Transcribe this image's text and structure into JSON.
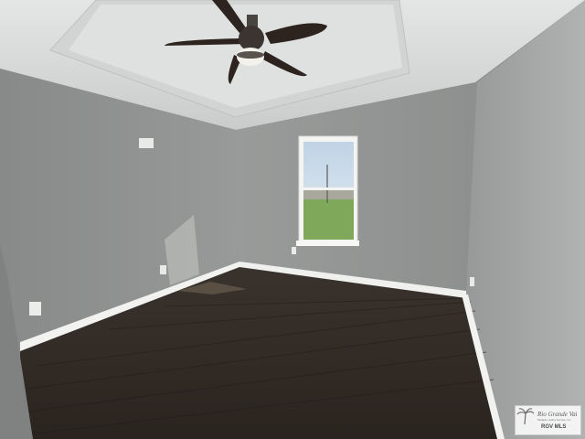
{
  "scene": {
    "description_tags": [
      "empty-bedroom",
      "tray-ceiling",
      "ceiling-fan",
      "window",
      "dark-wood-floor",
      "white-baseboards"
    ],
    "colors": {
      "wall_left": "#8f9291",
      "wall_back": "#9a9c9a",
      "wall_right": "#a5a7a6",
      "ceiling": "#d9dbda",
      "floor": "#2f2924",
      "baseboard": "#f2f2f0",
      "grass": "#7fa85a",
      "sky": "#cfdde9"
    }
  },
  "watermark": {
    "logo_text": "Rio Grande Valley Multiple Listing Service, Inc.",
    "abbrev": "RGV MLS"
  }
}
